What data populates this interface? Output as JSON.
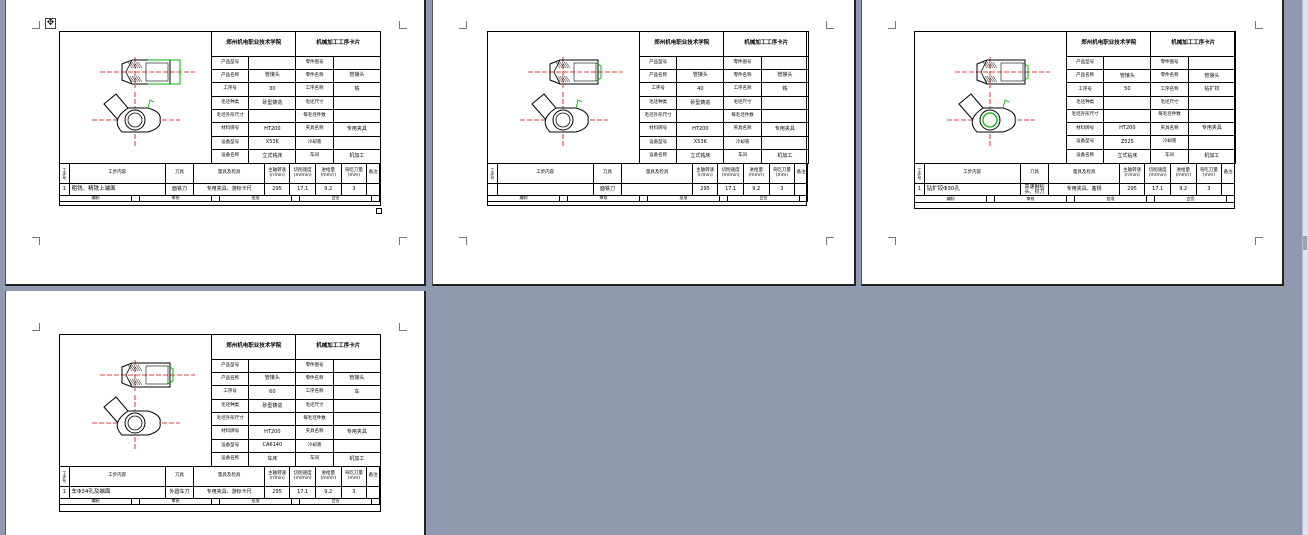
{
  "window": {
    "move_handle_icon": "✥"
  },
  "cards": [
    {
      "school": "郑州机电职业技术学院",
      "card_title": "机械加工工序卡片",
      "rows": [
        [
          "产品型号",
          "",
          "零件图号",
          ""
        ],
        [
          "产品名称",
          "管接头",
          "零件名称",
          "管接头"
        ],
        [
          "工序号",
          "30",
          "工序名称",
          "铣"
        ],
        [
          "毛坯种类",
          "砂型铸造",
          "毛坯尺寸",
          ""
        ],
        [
          "毛坯外形尺寸",
          "",
          "每毛坯件数",
          ""
        ],
        [
          "材料牌号",
          "HT200",
          "夹具名称",
          "专用夹具"
        ],
        [
          "设备型号",
          "X53K",
          "冷却液",
          ""
        ],
        [
          "设备名称",
          "立式铣床",
          "车间",
          "机加工"
        ]
      ],
      "op_headers": [
        "工步号",
        "工步内容",
        "刀具",
        "量具及检具",
        "主轴转速(r/min)",
        "切削速度(m/min)",
        "进给量(mm/r)",
        "背吃刀量(mm)",
        "备注"
      ],
      "op": {
        "no": "1",
        "content": "粗铣、精铣上端面",
        "tool": "面铣刀",
        "gauge": "专用夹具、游标卡尺",
        "speed": "295",
        "cut_speed": "17.1",
        "feed": "9.2",
        "depth": "3",
        "note": ""
      },
      "sign": [
        "编制",
        "审核",
        "批准",
        "会签"
      ]
    },
    {
      "school": "郑州机电职业技术学院",
      "card_title": "机械加工工序卡片",
      "rows": [
        [
          "产品型号",
          "",
          "零件图号",
          ""
        ],
        [
          "产品名称",
          "管接头",
          "零件名称",
          "管接头"
        ],
        [
          "工序号",
          "40",
          "工序名称",
          "铣"
        ],
        [
          "毛坯种类",
          "砂型铸造",
          "毛坯尺寸",
          ""
        ],
        [
          "毛坯外形尺寸",
          "",
          "每毛坯件数",
          ""
        ],
        [
          "材料牌号",
          "HT200",
          "夹具名称",
          "专用夹具"
        ],
        [
          "设备型号",
          "X53K",
          "冷却液",
          ""
        ],
        [
          "设备名称",
          "立式铣床",
          "车间",
          "机加工"
        ]
      ],
      "op_headers": [
        "工步号",
        "工步内容",
        "刀具",
        "量具及检具",
        "主轴转速(r/min)",
        "切削速度(m/min)",
        "进给量(mm/r)",
        "背吃刀量(mm)",
        "备注"
      ],
      "op": {
        "no": "",
        "content": "",
        "tool": "面铣刀",
        "gauge": "",
        "speed": "295",
        "cut_speed": "17.1",
        "feed": "9.2",
        "depth": "3",
        "note": ""
      },
      "sign": [
        "编制",
        "审核",
        "批准",
        "会签"
      ]
    },
    {
      "school": "郑州机电职业技术学院",
      "card_title": "机械加工工序卡片",
      "rows": [
        [
          "产品型号",
          "",
          "零件图号",
          ""
        ],
        [
          "产品名称",
          "管接头",
          "零件名称",
          "管接头"
        ],
        [
          "工序号",
          "50",
          "工序名称",
          "钻扩铰"
        ],
        [
          "毛坯种类",
          "",
          "毛坯尺寸",
          ""
        ],
        [
          "毛坯外形尺寸",
          "",
          "每毛坯件数",
          ""
        ],
        [
          "材料牌号",
          "HT200",
          "夹具名称",
          "专用夹具"
        ],
        [
          "设备型号",
          "Z525",
          "冷却液",
          ""
        ],
        [
          "设备名称",
          "立式钻床",
          "车间",
          "机加工"
        ]
      ],
      "op_headers": [
        "工步号",
        "工步内容",
        "刀具",
        "量具及检具",
        "主轴转速(r/min)",
        "切削速度(m/min)",
        "进给量(mm/r)",
        "背吃刀量(mm)",
        "备注"
      ],
      "op": {
        "no": "1",
        "content": "钻扩铰Φ30孔",
        "tool": "高速钢钻头、铰刀",
        "gauge": "专用夹具、塞规",
        "speed": "295",
        "cut_speed": "17.1",
        "feed": "9.2",
        "depth": "3",
        "note": ""
      },
      "sign": [
        "编制",
        "审核",
        "批准",
        "会签"
      ]
    },
    {
      "school": "郑州机电职业技术学院",
      "card_title": "机械加工工序卡片",
      "rows": [
        [
          "产品型号",
          "",
          "零件图号",
          ""
        ],
        [
          "产品名称",
          "管接头",
          "零件名称",
          "管接头"
        ],
        [
          "工序号",
          "60",
          "工序名称",
          "车"
        ],
        [
          "毛坯种类",
          "砂型铸造",
          "毛坯尺寸",
          ""
        ],
        [
          "毛坯外形尺寸",
          "",
          "每毛坯件数",
          ""
        ],
        [
          "材料牌号",
          "HT200",
          "夹具名称",
          "专用夹具"
        ],
        [
          "设备型号",
          "CA6140",
          "冷却液",
          ""
        ],
        [
          "设备名称",
          "车床",
          "车间",
          "机加工"
        ]
      ],
      "op_headers": [
        "工步号",
        "工步内容",
        "刀具",
        "量具及检具",
        "主轴转速(r/min)",
        "切削速度(m/min)",
        "进给量(mm/r)",
        "背吃刀量(mm)",
        "备注"
      ],
      "op": {
        "no": "1",
        "content": "车Φ34孔及端面",
        "tool": "外圆车刀",
        "gauge": "专用夹具、游标卡尺",
        "speed": "295",
        "cut_speed": "17.1",
        "feed": "9.2",
        "depth": "3",
        "note": ""
      },
      "sign": [
        "编制",
        "审核",
        "批准",
        "会签"
      ]
    }
  ]
}
